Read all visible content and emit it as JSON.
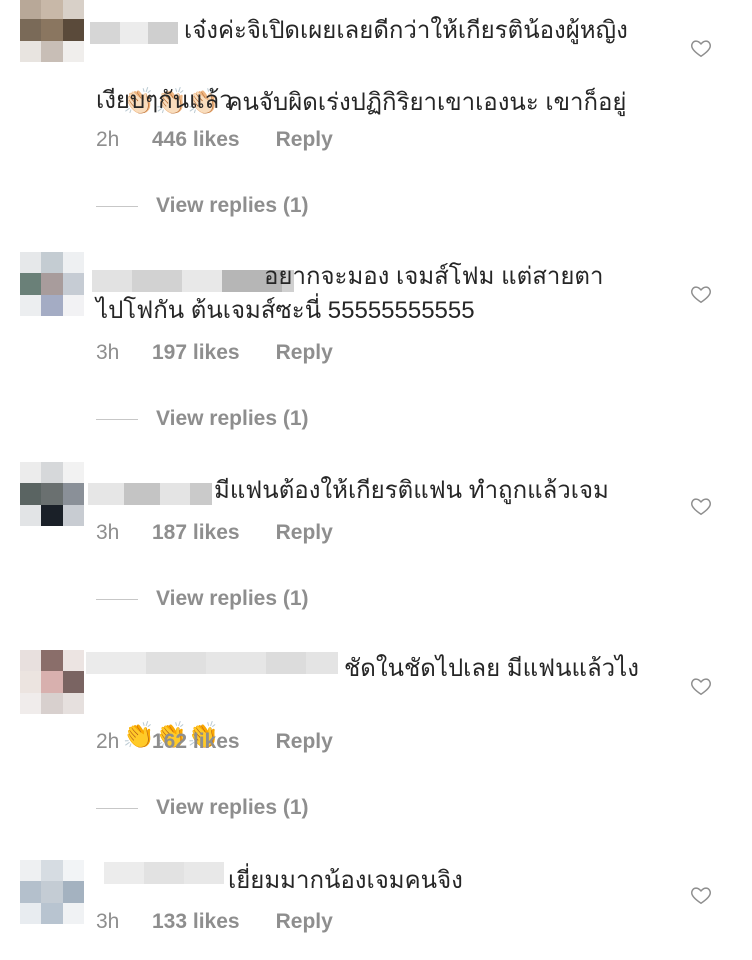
{
  "comments": [
    {
      "text_line1": "เจ๋งค่ะจิเปิดเผยเลยดีกว่าให้เกียรติน้องผู้หญิง",
      "emoji": "👏🏻👏🏻👏🏻",
      "text_line2": " คนจับผิดเร่งปฏิกิริยาเขาเองนะ เขาก็อยู่",
      "text_line3": "เงียบๆกันแล้ว",
      "time": "2h",
      "likes": "446 likes",
      "reply": "Reply",
      "view_replies": "View replies (1)"
    },
    {
      "text_line1": "อยากจะมอง เจมส์โฟม แต่สายตา",
      "text_line2": "ไปโฟกัน ต้นเจมส์ซะนี่ 55555555555",
      "time": "3h",
      "likes": "197 likes",
      "reply": "Reply",
      "view_replies": "View replies (1)"
    },
    {
      "text_line1": "มีแฟนต้องให้เกียรติแฟน ทำถูกแล้วเจม",
      "time": "3h",
      "likes": "187 likes",
      "reply": "Reply",
      "view_replies": "View replies (1)"
    },
    {
      "text_line1": "ชัดในชัดไปเลย มีแฟนแล้วไง",
      "emoji": "👏👏👏",
      "time": "2h",
      "likes": "162 likes",
      "reply": "Reply",
      "view_replies": "View replies (1)"
    },
    {
      "text_line1": "เยี่ยมมากน้องเจมคนจิง",
      "time": "3h",
      "likes": "133 likes",
      "reply": "Reply"
    }
  ],
  "icons": {
    "like": "heart-outline-icon"
  },
  "colors": {
    "text": "#262626",
    "meta": "#8e8e8e",
    "heart": "#8e8e8e"
  }
}
